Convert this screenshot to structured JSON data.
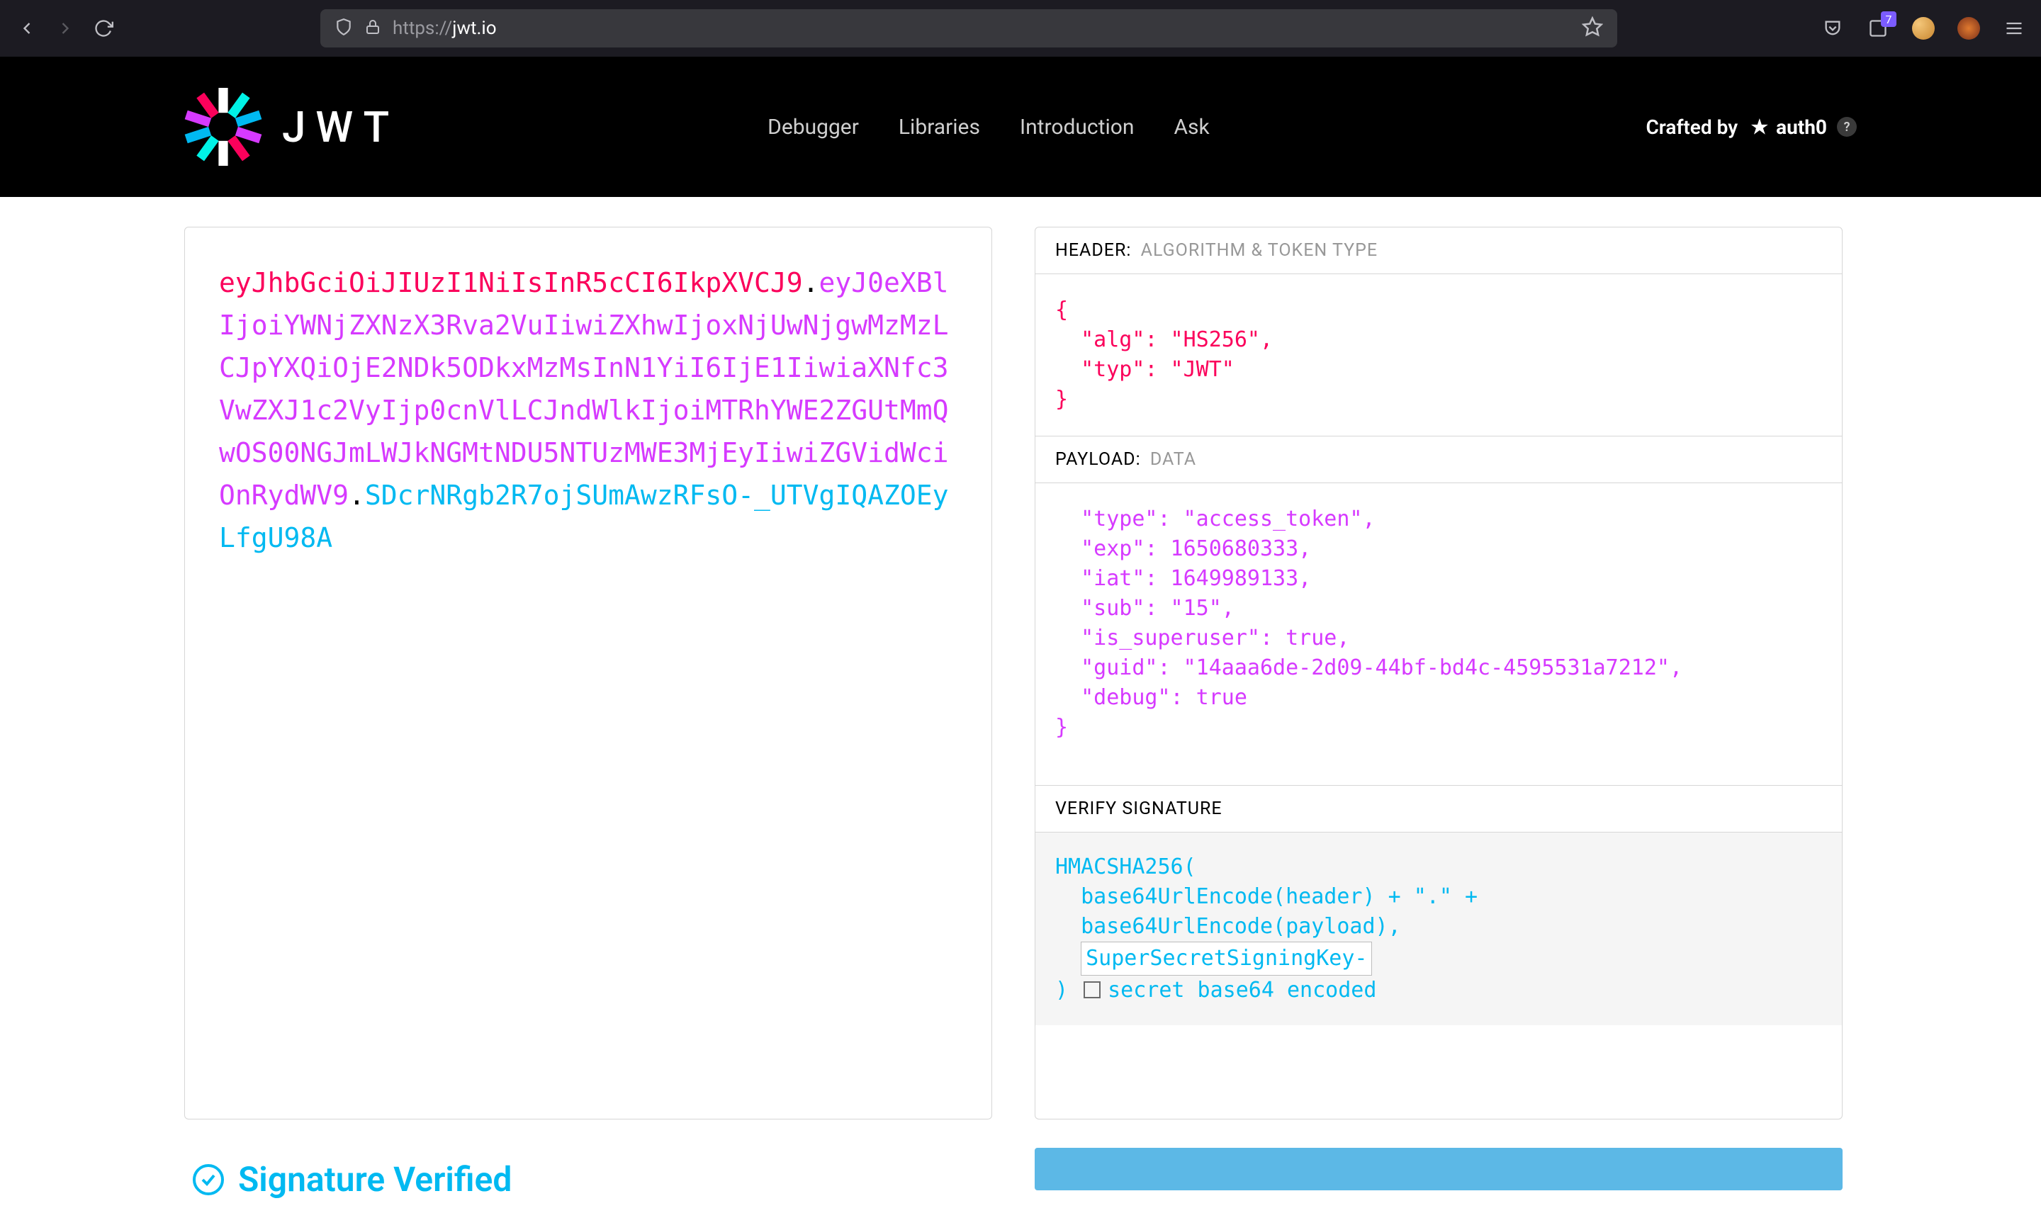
{
  "browser": {
    "url_prefix": "https://",
    "url_host": "jwt.io",
    "ext_badge": "7"
  },
  "header": {
    "brand_text": "JWT",
    "nav": {
      "debugger": "Debugger",
      "libraries": "Libraries",
      "introduction": "Introduction",
      "ask": "Ask"
    },
    "crafted_by": "Crafted by",
    "auth0": "auth0",
    "help": "?"
  },
  "token": {
    "header": "eyJhbGciOiJIUzI1NiIsInR5cCI6IkpXVCJ9",
    "dot": ".",
    "payload": "eyJ0eXBlIjoiYWNjZXNzX3Rva2VuIiwiZXhwIjoxNjUwNjgwMzMzLCJpYXQiOjE2NDk5ODkxMzMsInN1YiI6IjE1IiwiaXNfc3VwZXJ1c2VyIjp0cnVlLCJndWlkIjoiMTRhYWE2ZGUtMmQwOS00NGJmLWJkNGMtNDU5NTUzMWE3MjEyIiwiZGVidWciOnRydWV9",
    "signature": "SDcrNRgb2R7ojSUmAwzRFsO-_UTVgIQAZOEyLfgU98A"
  },
  "decoded": {
    "header_section": {
      "title": "HEADER:",
      "sub": "ALGORITHM & TOKEN TYPE"
    },
    "header_json": "{\n  \"alg\": \"HS256\",\n  \"typ\": \"JWT\"\n}",
    "payload_section": {
      "title": "PAYLOAD:",
      "sub": "DATA"
    },
    "payload_json": "  \"type\": \"access_token\",\n  \"exp\": 1650680333,\n  \"iat\": 1649989133,\n  \"sub\": \"15\",\n  \"is_superuser\": true,\n  \"guid\": \"14aaa6de-2d09-44bf-bd4c-4595531a7212\",\n  \"debug\": true\n}",
    "verify_section": {
      "title": "VERIFY SIGNATURE"
    },
    "verify": {
      "line1": "HMACSHA256(",
      "line2": "  base64UrlEncode(header) + \".\" +",
      "line3": "  base64UrlEncode(payload),",
      "secret": "SuperSecretSigningKey-",
      "close": ")",
      "cb_label": "secret base64 encoded"
    }
  },
  "footer": {
    "verified": "Signature Verified"
  }
}
